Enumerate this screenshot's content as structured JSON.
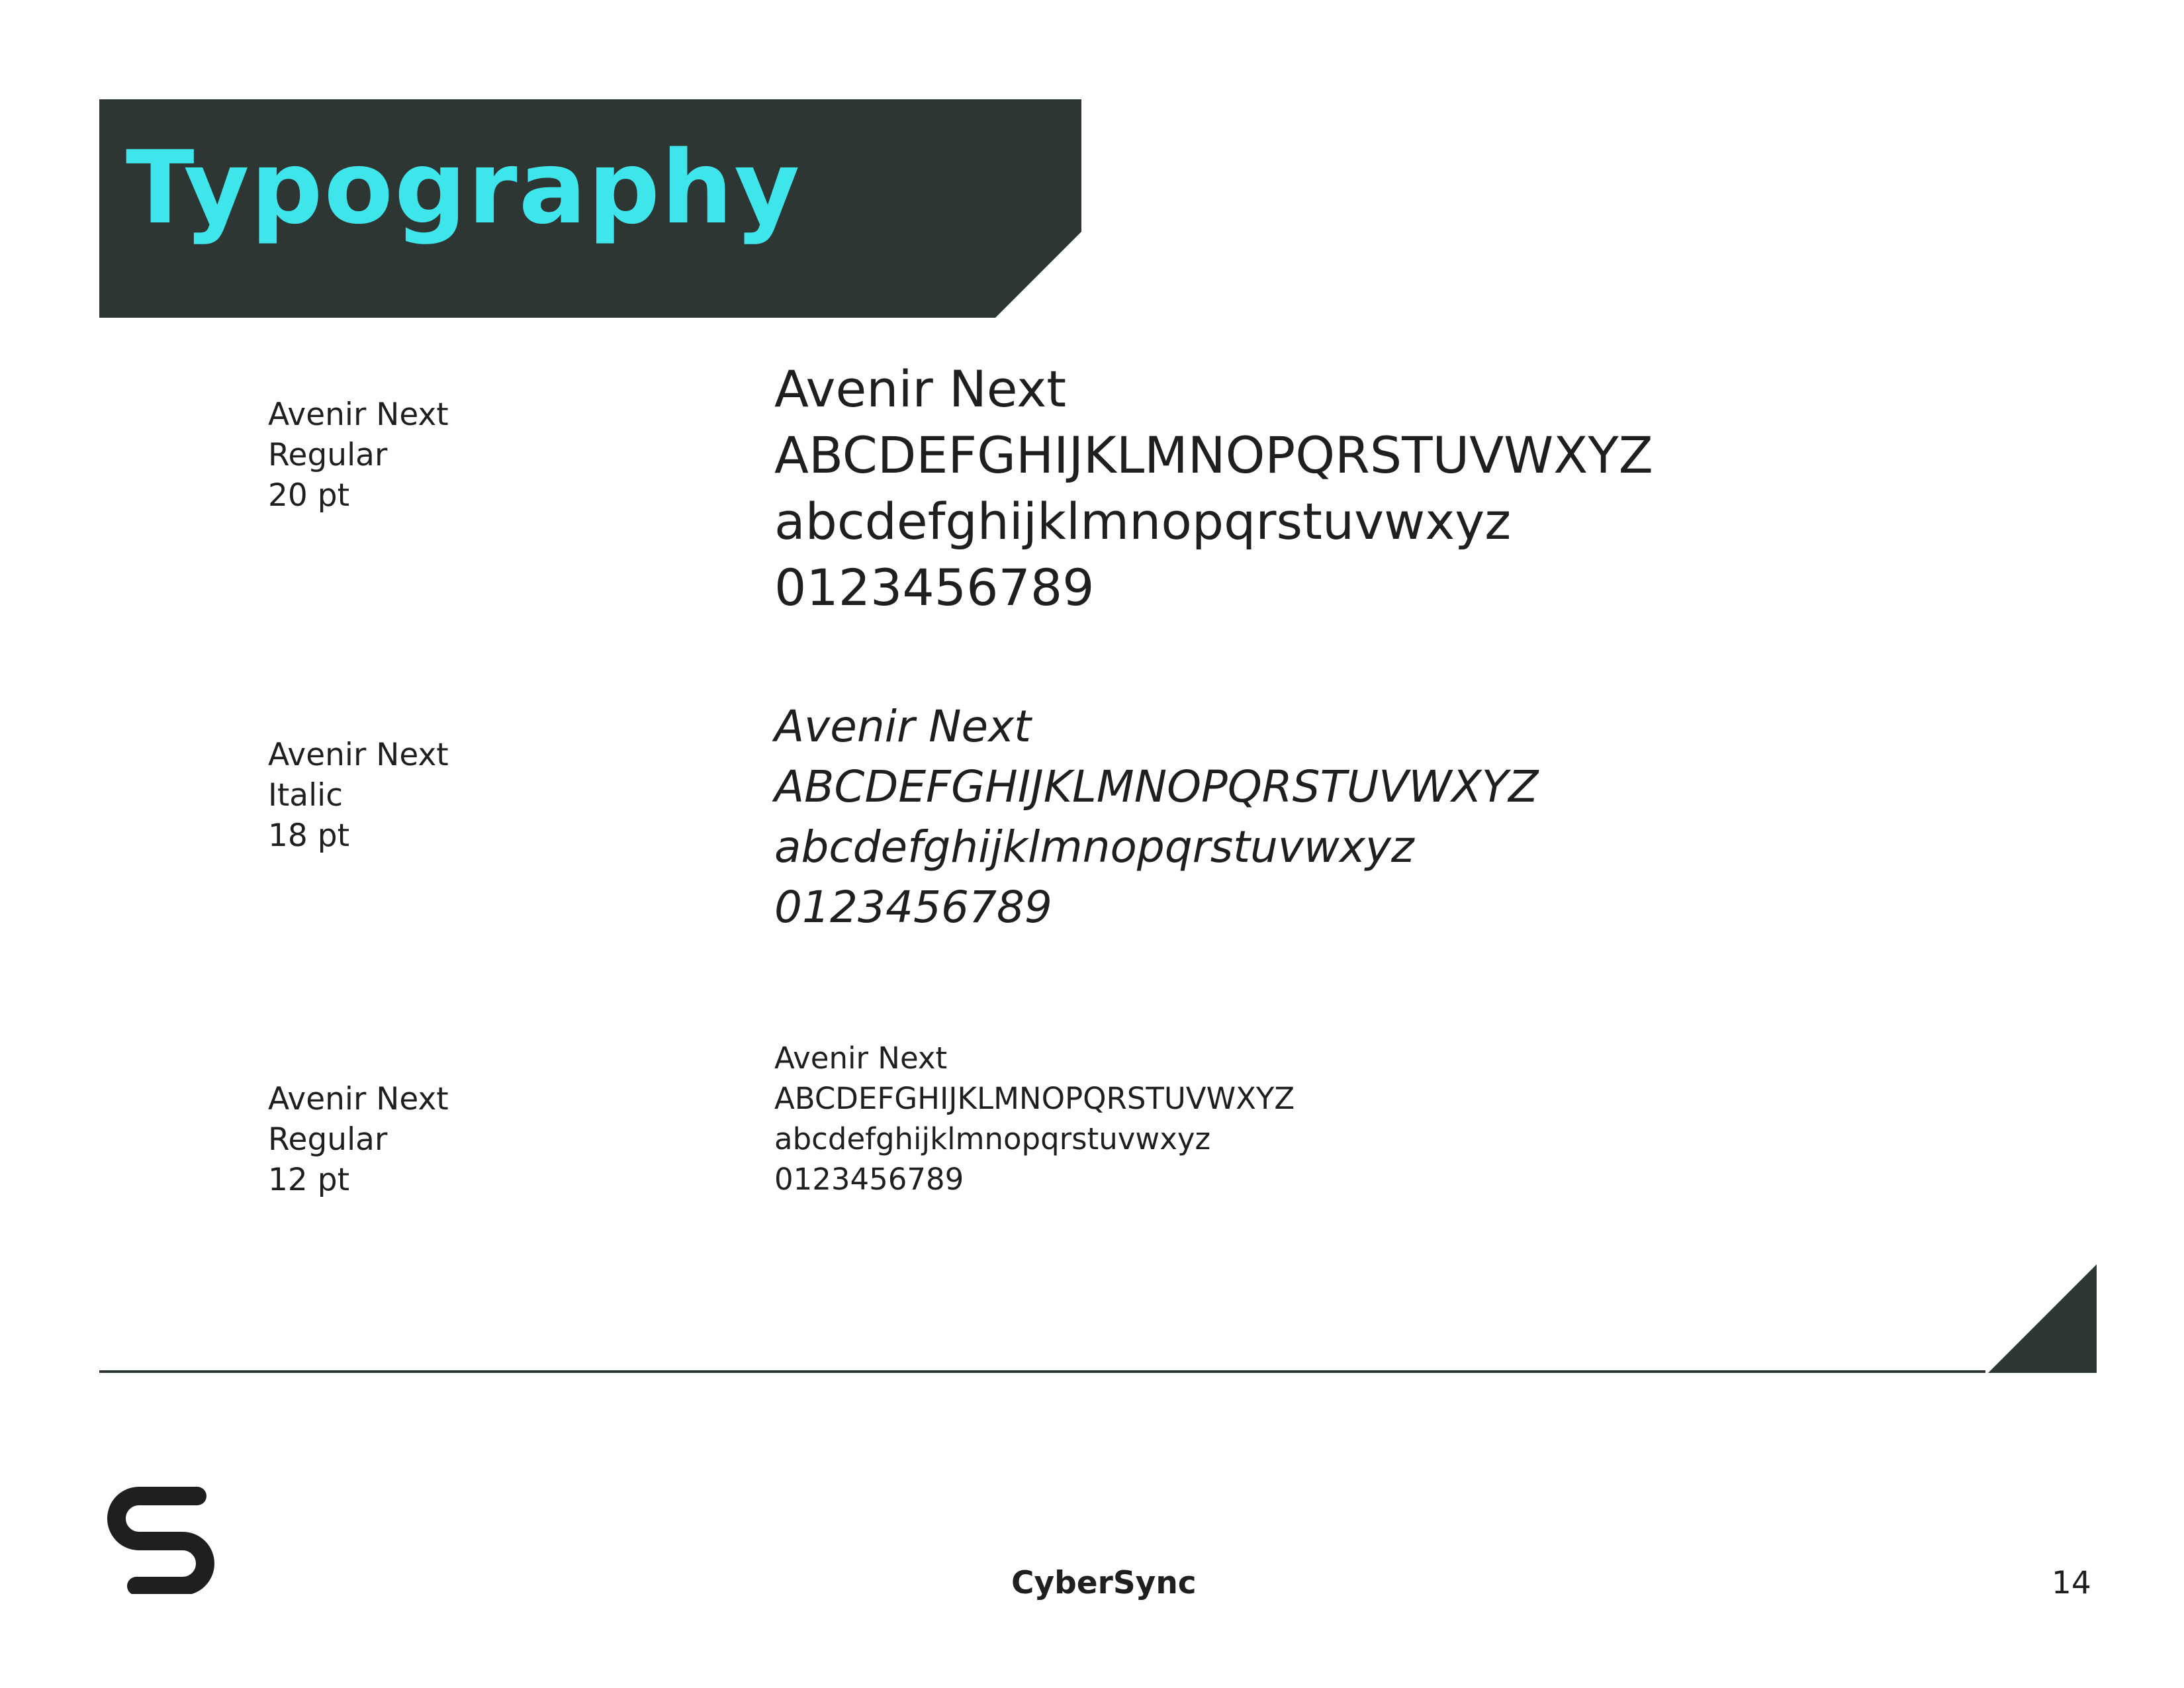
{
  "header": {
    "title": "Typography",
    "title_color": "#3ee6ec",
    "bar_color": "#2d3633"
  },
  "specimens": [
    {
      "spec": {
        "family": "Avenir Next",
        "style": "Regular",
        "size": "20 pt"
      },
      "sample": {
        "name": "Avenir Next",
        "upper": "ABCDEFGHIJKLMNOPQRSTUVWXYZ",
        "lower": "abcdefghijklmnopqrstuvwxyz",
        "digits": "0123456789"
      }
    },
    {
      "spec": {
        "family": "Avenir Next",
        "style": "Italic",
        "size": "18 pt"
      },
      "sample": {
        "name": "Avenir Next",
        "upper": "ABCDEFGHIJKLMNOPQRSTUVWXYZ",
        "lower": "abcdefghijklmnopqrstuvwxyz",
        "digits": "0123456789"
      }
    },
    {
      "spec": {
        "family": "Avenir Next",
        "style": "Regular",
        "size": "12 pt"
      },
      "sample": {
        "name": "Avenir Next",
        "upper": "ABCDEFGHIJKLMNOPQRSTUVWXYZ",
        "lower": "abcdefghijklmnopqrstuvwxyz",
        "digits": "0123456789"
      }
    }
  ],
  "footer": {
    "brand": "CyberSync",
    "page_number": "14",
    "logo_icon": "cybersync-logo-icon"
  }
}
